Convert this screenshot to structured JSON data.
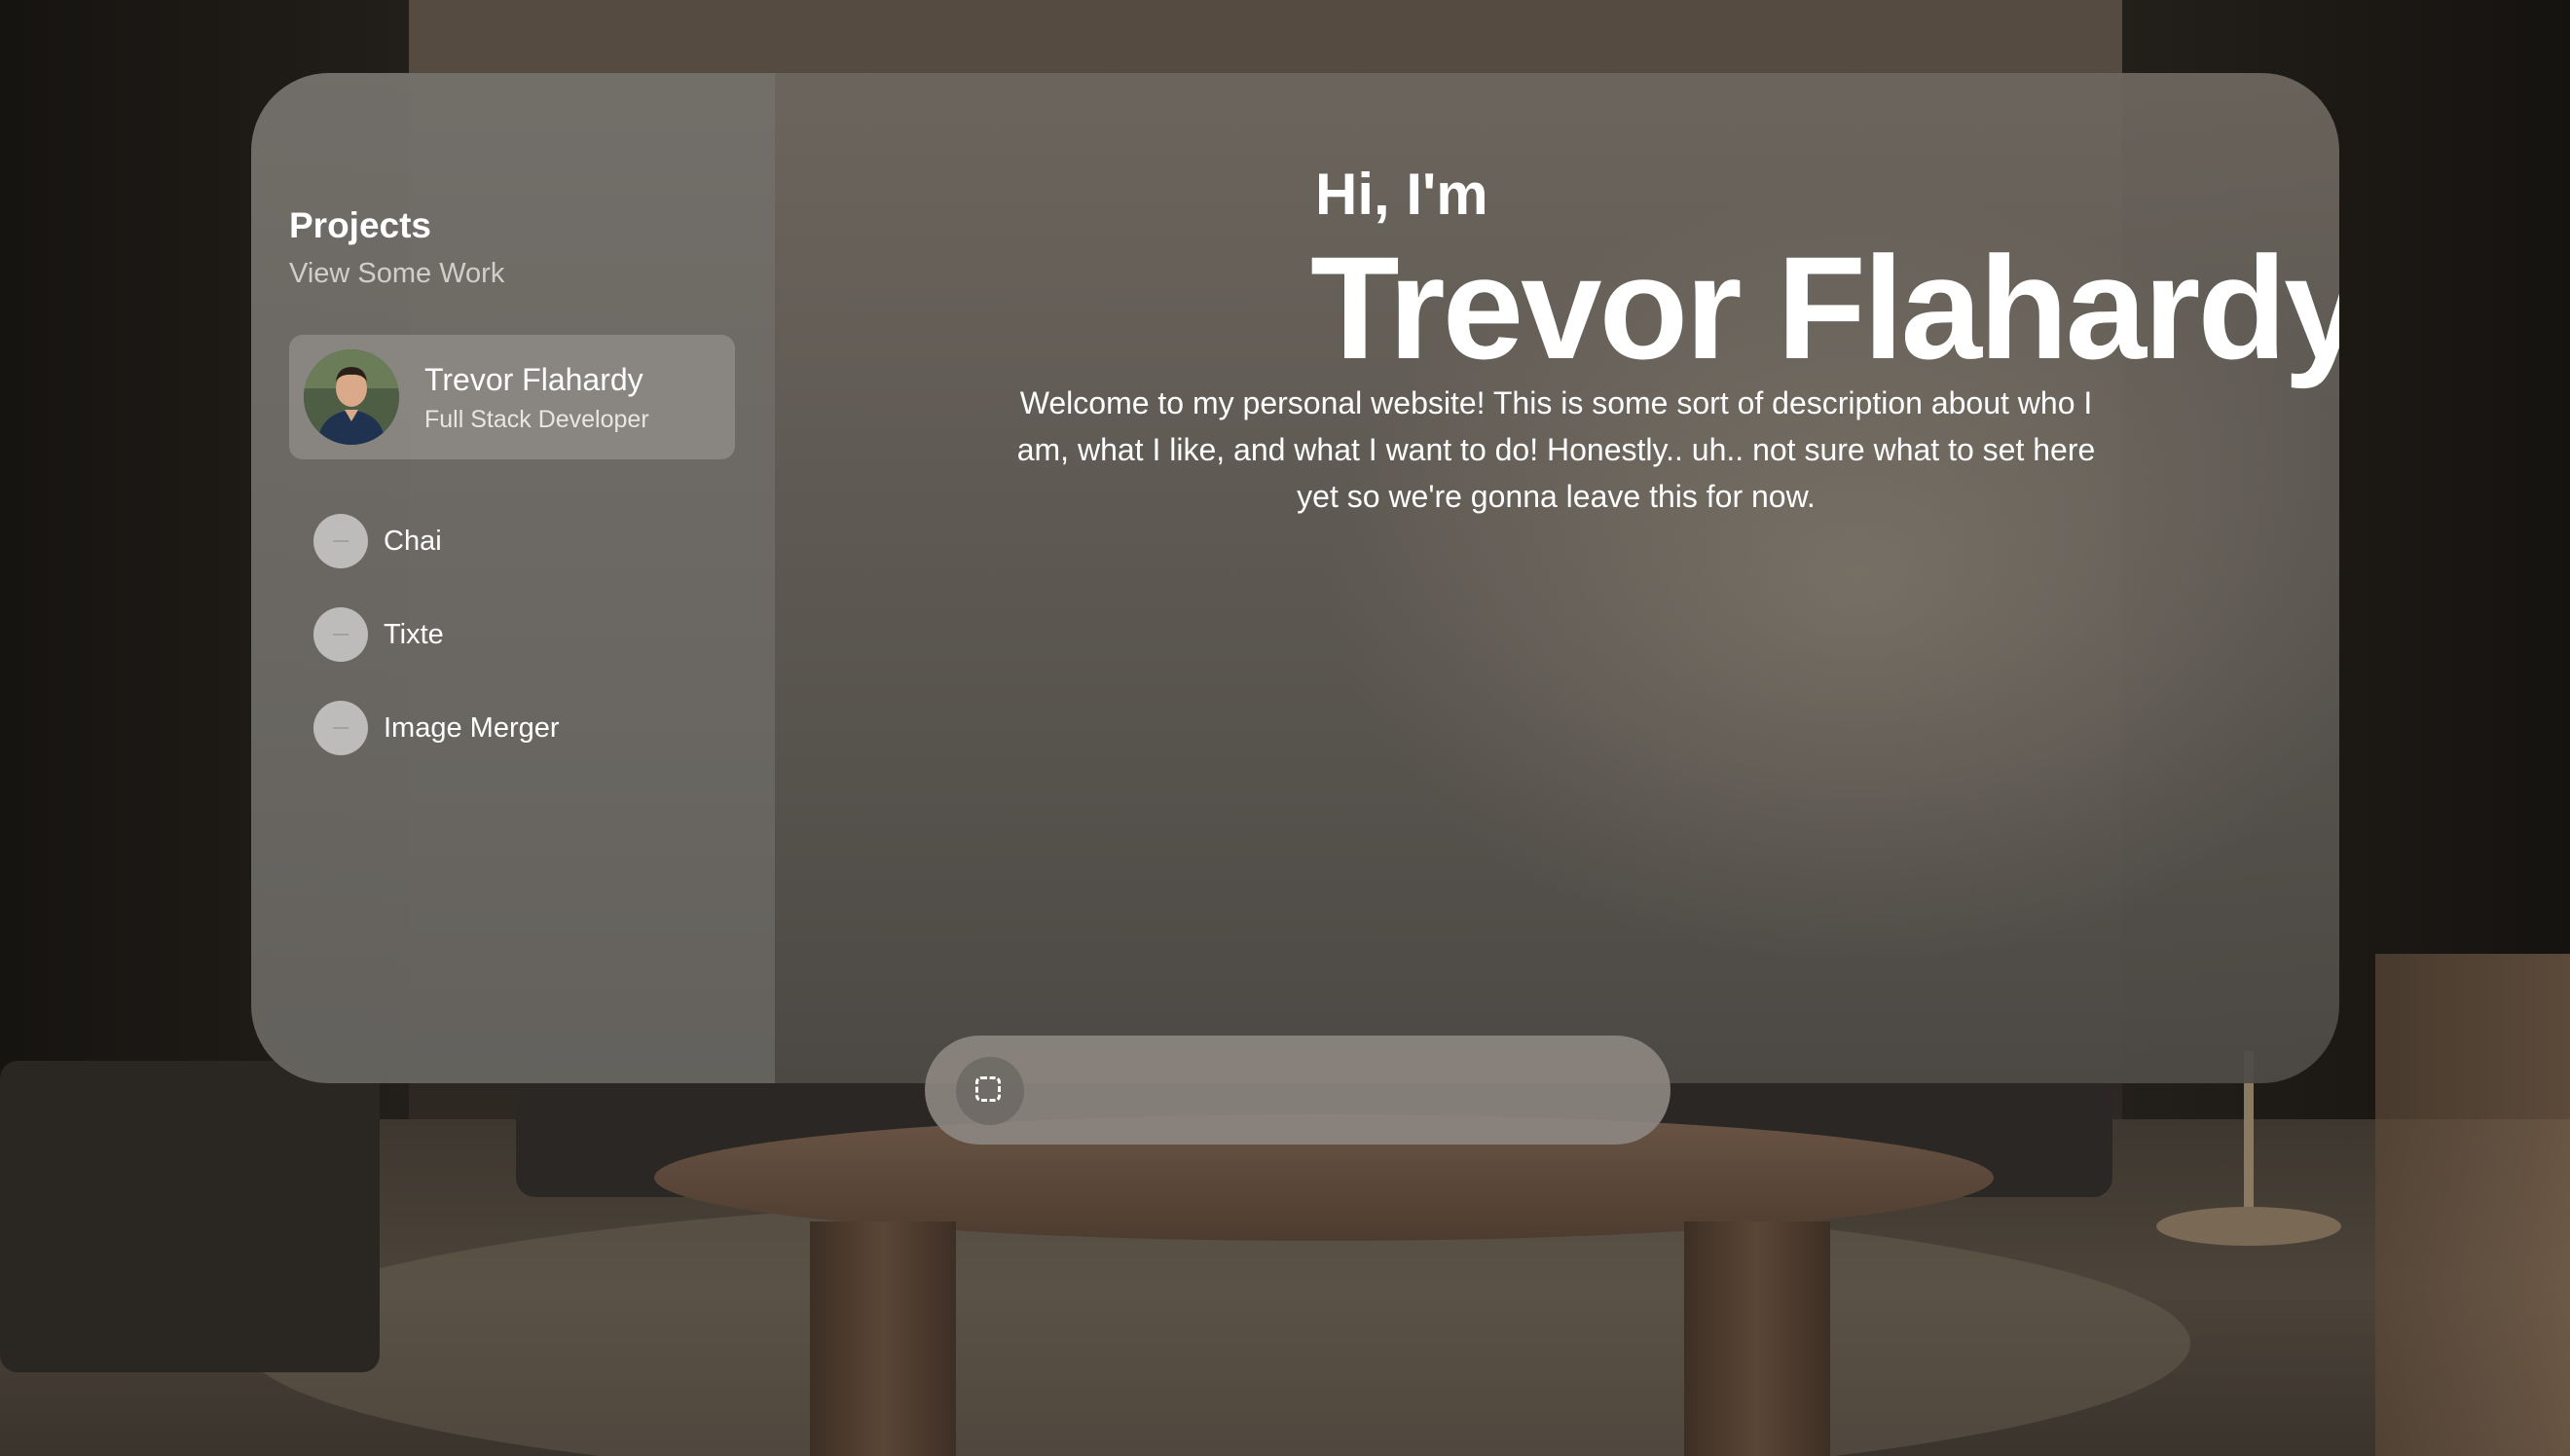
{
  "sidebar": {
    "title": "Projects",
    "subtitle": "View Some Work",
    "profile": {
      "name": "Trevor Flahardy",
      "role": "Full Stack Developer",
      "avatar_icon": "avatar-photo"
    },
    "items": [
      {
        "label": "Chai",
        "icon": "project-icon"
      },
      {
        "label": "Tixte",
        "icon": "project-icon"
      },
      {
        "label": "Image Merger",
        "icon": "project-icon"
      }
    ]
  },
  "main": {
    "greeting": "Hi, I'm",
    "name": "Trevor Flahardy",
    "description": "Welcome to my personal website! This is some sort of description about who I am, what I like, and what I want to do! Honestly.. uh.. not sure what to set here yet so we're gonna leave this for now."
  },
  "toolbar": {
    "button_icon": "select-region-icon"
  },
  "colors": {
    "text": "#ffffff",
    "window_bg": "#5e5a55",
    "sidebar_bg": "#75726e",
    "card_bg": "#8f8d8a"
  }
}
